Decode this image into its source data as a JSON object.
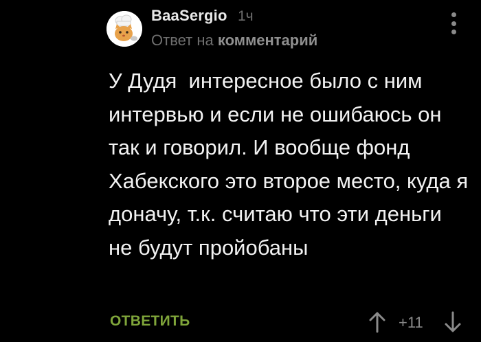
{
  "comment": {
    "author": "BaaSergio",
    "time": "1ч",
    "reply_prefix": "Ответ на",
    "reply_target": "комментарий",
    "text": "У Дудя  интересное было с ним интервью и если не ошибаюсь он так и говорил. И вообще фонд Хабекского это второе место, куда я доначу, т.к. считаю что эти деньги не будут пройобаны",
    "reply_label": "ОТВЕТИТЬ",
    "rating": "+11"
  },
  "icons": {
    "avatar": "avatar-cat-chef",
    "menu": "more-vertical-icon",
    "upvote": "arrow-up-icon",
    "downvote": "arrow-down-icon"
  },
  "colors": {
    "background": "#000000",
    "accent_green": "#7fa53a",
    "muted_text": "#6f6f6f"
  }
}
